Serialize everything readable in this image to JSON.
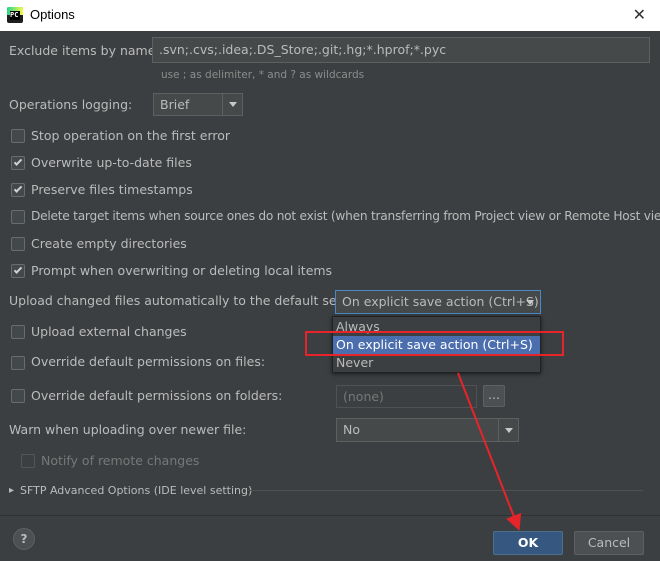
{
  "window": {
    "title": "Options",
    "close_glyph": "✕"
  },
  "exclude": {
    "label": "Exclude items by name:",
    "value": ".svn;.cvs;.idea;.DS_Store;.git;.hg;*.hprof;*.pyc",
    "hint": "use ; as delimiter, * and ? as wildcards"
  },
  "logging": {
    "label": "Operations logging:",
    "value": "Brief"
  },
  "checkboxes": [
    {
      "label": "Stop operation on the first error",
      "checked": false
    },
    {
      "label": "Overwrite up-to-date files",
      "checked": true
    },
    {
      "label": "Preserve files timestamps",
      "checked": true
    },
    {
      "label": "Delete target items when source ones do not exist (when transferring from Project view or Remote Host view)",
      "checked": false
    },
    {
      "label": "Create empty directories",
      "checked": false
    },
    {
      "label": "Prompt when overwriting or deleting local items",
      "checked": true
    }
  ],
  "upload": {
    "label": "Upload changed files automatically to the default server",
    "value": "On explicit save action (Ctrl+S)",
    "options": [
      "Always",
      "On explicit save action (Ctrl+S)",
      "Never"
    ],
    "selected_index": 1
  },
  "external": {
    "label": "Upload external changes",
    "checked": false
  },
  "override_files": {
    "label": "Override default permissions on files:",
    "checked": false
  },
  "override_folders": {
    "label": "Override default permissions on folders:",
    "checked": false,
    "value": "(none)",
    "browse": "..."
  },
  "warn": {
    "label": "Warn when uploading over newer file:",
    "value": "No"
  },
  "notify": {
    "label": "Notify of remote changes",
    "checked": false
  },
  "sftp": {
    "label": "SFTP Advanced Options (IDE level setting)"
  },
  "buttons": {
    "help": "?",
    "ok": "OK",
    "cancel": "Cancel"
  },
  "colors": {
    "background": "#3c3f41",
    "selection": "#4b6eaf",
    "annotation": "#e8242b",
    "ok_button": "#365880"
  }
}
